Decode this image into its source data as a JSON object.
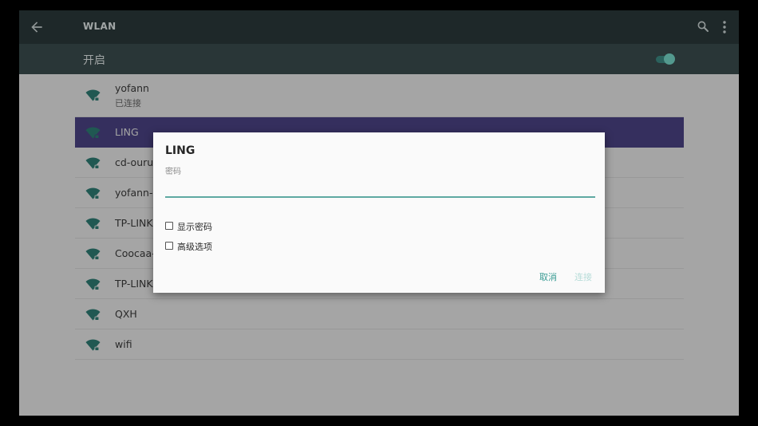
{
  "appbar": {
    "title": "WLAN",
    "icons": {
      "back": "arrow-back-icon",
      "search": "search-icon",
      "more": "more-vert-icon"
    }
  },
  "switchbar": {
    "label": "开启",
    "toggle_on": true
  },
  "networks": [
    {
      "name": "yofann",
      "status": "已连接"
    },
    {
      "name": "LING"
    },
    {
      "name": "cd-ourui"
    },
    {
      "name": "yofann-2"
    },
    {
      "name": "TP-LINK"
    },
    {
      "name": "Coocaa-"
    },
    {
      "name": "TP-LINK"
    },
    {
      "name": "QXH"
    },
    {
      "name": "wifi"
    }
  ],
  "dialog": {
    "title": "LING",
    "password_label": "密码",
    "password_value": "",
    "show_password_label": "显示密码",
    "advanced_label": "高级选项",
    "cancel_label": "取消",
    "connect_label": "连接"
  },
  "colors": {
    "appbar": "#2c3a3c",
    "switchbar": "#3c4e50",
    "selected_row": "#4c4487",
    "accent": "#3a9c94",
    "wifi_icon": "#2f7f76"
  }
}
